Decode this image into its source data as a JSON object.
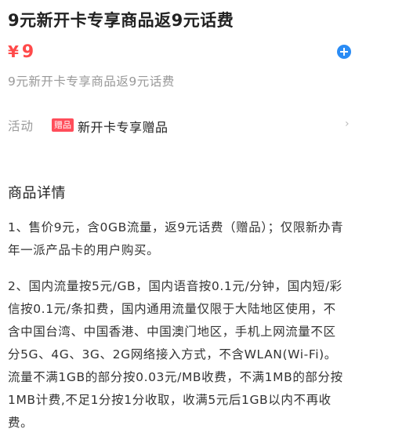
{
  "product": {
    "title": "9元新开卡专享商品返9元话费",
    "currency": "¥",
    "price": "9",
    "subtitle": "9元新开卡专享商品返9元话费"
  },
  "activity": {
    "label": "活动",
    "badge": "赠品",
    "text": "新开卡专享赠品"
  },
  "details": {
    "heading": "商品详情",
    "paragraphs": [
      "1、售价9元，含0GB流量，返9元话费（赠品）；仅限新办青年一派产品卡的用户购买。",
      "2、国内流量按5元/GB，国内语音按0.1元/分钟，国内短/彩信按0.1元/条扣费，国内通用流量仅限于大陆地区使用，不含中国台湾、中国香港、中国澳门地区，手机上网流量不区分5G、4G、3G、2G网络接入方式，不含WLAN(Wi-Fi)。流量不满1GB的部分按0.03元/MB收费，不满1MB的部分按1MB计费,不足1分按1分收取，收满5元后1GB以内不再收费。"
    ]
  },
  "colors": {
    "price": "#ff4a4a",
    "accent": "#2a8cf5",
    "badge": "#ff4d5a"
  },
  "icons": {
    "add": "plus-circle-icon",
    "more": "chevron-right-icon"
  }
}
